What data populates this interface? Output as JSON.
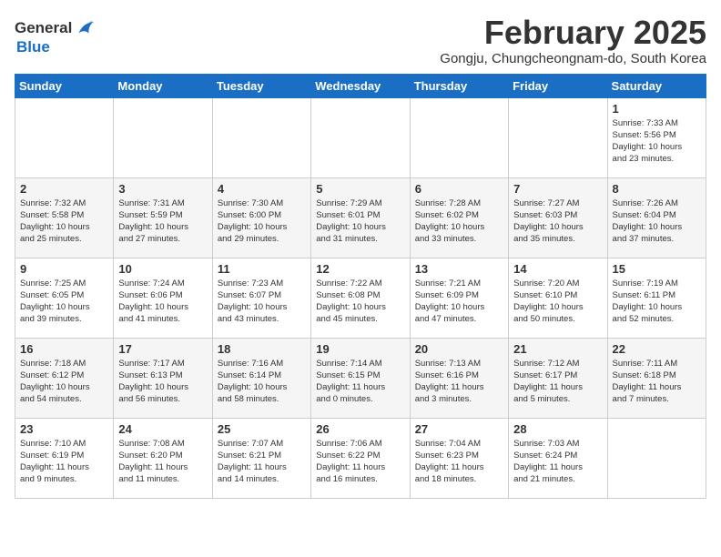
{
  "logo": {
    "general": "General",
    "blue": "Blue"
  },
  "title": "February 2025",
  "location": "Gongju, Chungcheongnam-do, South Korea",
  "days_of_week": [
    "Sunday",
    "Monday",
    "Tuesday",
    "Wednesday",
    "Thursday",
    "Friday",
    "Saturday"
  ],
  "weeks": [
    [
      {
        "day": "",
        "info": ""
      },
      {
        "day": "",
        "info": ""
      },
      {
        "day": "",
        "info": ""
      },
      {
        "day": "",
        "info": ""
      },
      {
        "day": "",
        "info": ""
      },
      {
        "day": "",
        "info": ""
      },
      {
        "day": "1",
        "info": "Sunrise: 7:33 AM\nSunset: 5:56 PM\nDaylight: 10 hours\nand 23 minutes."
      }
    ],
    [
      {
        "day": "2",
        "info": "Sunrise: 7:32 AM\nSunset: 5:58 PM\nDaylight: 10 hours\nand 25 minutes."
      },
      {
        "day": "3",
        "info": "Sunrise: 7:31 AM\nSunset: 5:59 PM\nDaylight: 10 hours\nand 27 minutes."
      },
      {
        "day": "4",
        "info": "Sunrise: 7:30 AM\nSunset: 6:00 PM\nDaylight: 10 hours\nand 29 minutes."
      },
      {
        "day": "5",
        "info": "Sunrise: 7:29 AM\nSunset: 6:01 PM\nDaylight: 10 hours\nand 31 minutes."
      },
      {
        "day": "6",
        "info": "Sunrise: 7:28 AM\nSunset: 6:02 PM\nDaylight: 10 hours\nand 33 minutes."
      },
      {
        "day": "7",
        "info": "Sunrise: 7:27 AM\nSunset: 6:03 PM\nDaylight: 10 hours\nand 35 minutes."
      },
      {
        "day": "8",
        "info": "Sunrise: 7:26 AM\nSunset: 6:04 PM\nDaylight: 10 hours\nand 37 minutes."
      }
    ],
    [
      {
        "day": "9",
        "info": "Sunrise: 7:25 AM\nSunset: 6:05 PM\nDaylight: 10 hours\nand 39 minutes."
      },
      {
        "day": "10",
        "info": "Sunrise: 7:24 AM\nSunset: 6:06 PM\nDaylight: 10 hours\nand 41 minutes."
      },
      {
        "day": "11",
        "info": "Sunrise: 7:23 AM\nSunset: 6:07 PM\nDaylight: 10 hours\nand 43 minutes."
      },
      {
        "day": "12",
        "info": "Sunrise: 7:22 AM\nSunset: 6:08 PM\nDaylight: 10 hours\nand 45 minutes."
      },
      {
        "day": "13",
        "info": "Sunrise: 7:21 AM\nSunset: 6:09 PM\nDaylight: 10 hours\nand 47 minutes."
      },
      {
        "day": "14",
        "info": "Sunrise: 7:20 AM\nSunset: 6:10 PM\nDaylight: 10 hours\nand 50 minutes."
      },
      {
        "day": "15",
        "info": "Sunrise: 7:19 AM\nSunset: 6:11 PM\nDaylight: 10 hours\nand 52 minutes."
      }
    ],
    [
      {
        "day": "16",
        "info": "Sunrise: 7:18 AM\nSunset: 6:12 PM\nDaylight: 10 hours\nand 54 minutes."
      },
      {
        "day": "17",
        "info": "Sunrise: 7:17 AM\nSunset: 6:13 PM\nDaylight: 10 hours\nand 56 minutes."
      },
      {
        "day": "18",
        "info": "Sunrise: 7:16 AM\nSunset: 6:14 PM\nDaylight: 10 hours\nand 58 minutes."
      },
      {
        "day": "19",
        "info": "Sunrise: 7:14 AM\nSunset: 6:15 PM\nDaylight: 11 hours\nand 0 minutes."
      },
      {
        "day": "20",
        "info": "Sunrise: 7:13 AM\nSunset: 6:16 PM\nDaylight: 11 hours\nand 3 minutes."
      },
      {
        "day": "21",
        "info": "Sunrise: 7:12 AM\nSunset: 6:17 PM\nDaylight: 11 hours\nand 5 minutes."
      },
      {
        "day": "22",
        "info": "Sunrise: 7:11 AM\nSunset: 6:18 PM\nDaylight: 11 hours\nand 7 minutes."
      }
    ],
    [
      {
        "day": "23",
        "info": "Sunrise: 7:10 AM\nSunset: 6:19 PM\nDaylight: 11 hours\nand 9 minutes."
      },
      {
        "day": "24",
        "info": "Sunrise: 7:08 AM\nSunset: 6:20 PM\nDaylight: 11 hours\nand 11 minutes."
      },
      {
        "day": "25",
        "info": "Sunrise: 7:07 AM\nSunset: 6:21 PM\nDaylight: 11 hours\nand 14 minutes."
      },
      {
        "day": "26",
        "info": "Sunrise: 7:06 AM\nSunset: 6:22 PM\nDaylight: 11 hours\nand 16 minutes."
      },
      {
        "day": "27",
        "info": "Sunrise: 7:04 AM\nSunset: 6:23 PM\nDaylight: 11 hours\nand 18 minutes."
      },
      {
        "day": "28",
        "info": "Sunrise: 7:03 AM\nSunset: 6:24 PM\nDaylight: 11 hours\nand 21 minutes."
      },
      {
        "day": "",
        "info": ""
      }
    ]
  ]
}
